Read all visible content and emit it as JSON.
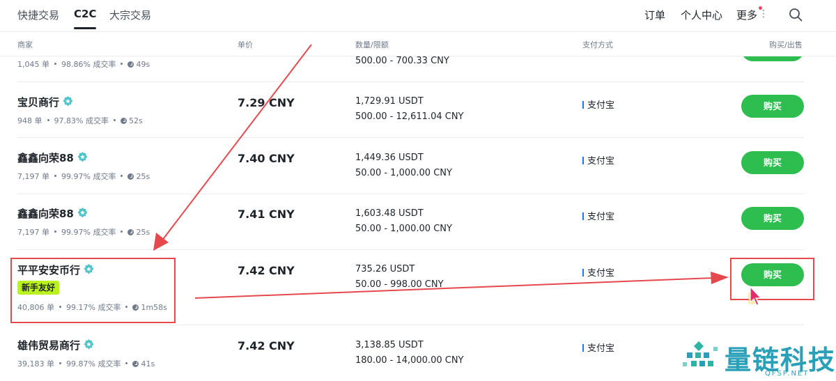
{
  "nav": {
    "tabs": [
      "快捷交易",
      "C2C",
      "大宗交易"
    ],
    "active_tab": "C2C",
    "right": {
      "orders": "订单",
      "profile": "个人中心",
      "more": "更多"
    }
  },
  "table": {
    "headers": {
      "merchant": "商家",
      "price": "单价",
      "amount": "数量/限额",
      "payment": "支付方式",
      "action": "购买/出售"
    }
  },
  "rows": [
    {
      "merchant": "",
      "badge": "",
      "orders": "1,045 单",
      "rate": "98.86% 成交率",
      "time": "49s",
      "price": "",
      "amount": "",
      "limit": "500.00 - 700.33 CNY",
      "pay": "",
      "action": ""
    },
    {
      "merchant": "宝贝商行",
      "badge": "",
      "orders": "948 单",
      "rate": "97.83% 成交率",
      "time": "52s",
      "price": "7.29 CNY",
      "amount": "1,729.91 USDT",
      "limit": "500.00 - 12,611.04 CNY",
      "pay": "支付宝",
      "action": "购买"
    },
    {
      "merchant": "鑫鑫向荣88",
      "badge": "",
      "orders": "7,197 单",
      "rate": "99.97% 成交率",
      "time": "25s",
      "price": "7.40 CNY",
      "amount": "1,449.36 USDT",
      "limit": "50.00 - 1,000.00 CNY",
      "pay": "支付宝",
      "action": "购买"
    },
    {
      "merchant": "鑫鑫向荣88",
      "badge": "",
      "orders": "7,197 单",
      "rate": "99.97% 成交率",
      "time": "25s",
      "price": "7.41 CNY",
      "amount": "1,603.48 USDT",
      "limit": "50.00 - 1,000.00 CNY",
      "pay": "支付宝",
      "action": "购买"
    },
    {
      "merchant": "平平安安币行",
      "badge": "新手友好",
      "orders": "40,806 单",
      "rate": "99.17% 成交率",
      "time": "1m58s",
      "price": "7.42 CNY",
      "amount": "735.26 USDT",
      "limit": "50.00 - 998.00 CNY",
      "pay": "支付宝",
      "action": "购买"
    },
    {
      "merchant": "雄伟贸易商行",
      "badge": "",
      "orders": "39,183 单",
      "rate": "99.87% 成交率",
      "time": "41s",
      "price": "7.42 CNY",
      "amount": "3,138.85 USDT",
      "limit": "180.00 - 14,000.00 CNY",
      "pay": "支付宝",
      "action": ""
    }
  ],
  "watermark": {
    "name": "量链科技",
    "domain": "QFSP.NET"
  },
  "colors": {
    "buy": "#2ebd4f",
    "badge": "#b9f21f",
    "annotation": "#e5484d",
    "watermark": "#2a9fb8"
  },
  "icons": [
    "search-icon",
    "verified-icon",
    "clock-icon",
    "cursor-icon",
    "kebab-icon"
  ]
}
